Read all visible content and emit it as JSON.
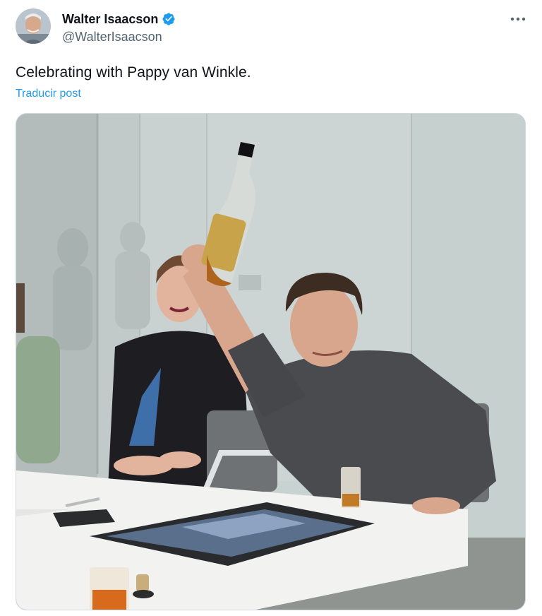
{
  "post": {
    "author": {
      "display_name": "Walter Isaacson",
      "handle": "@WalterIsaacson",
      "verified": true,
      "avatar_icon": "author-avatar"
    },
    "more_icon": "more-options-icon",
    "text": "Celebrating with Pappy van Winkle.",
    "translate_link": "Traducir post",
    "media": {
      "type": "photo",
      "icon": "photo-media"
    }
  },
  "colors": {
    "text_primary": "#0f1419",
    "text_secondary": "#536471",
    "link": "#1d9bf0",
    "verified_badge": "#1d9bf0",
    "media_border": "#cfd9de"
  }
}
